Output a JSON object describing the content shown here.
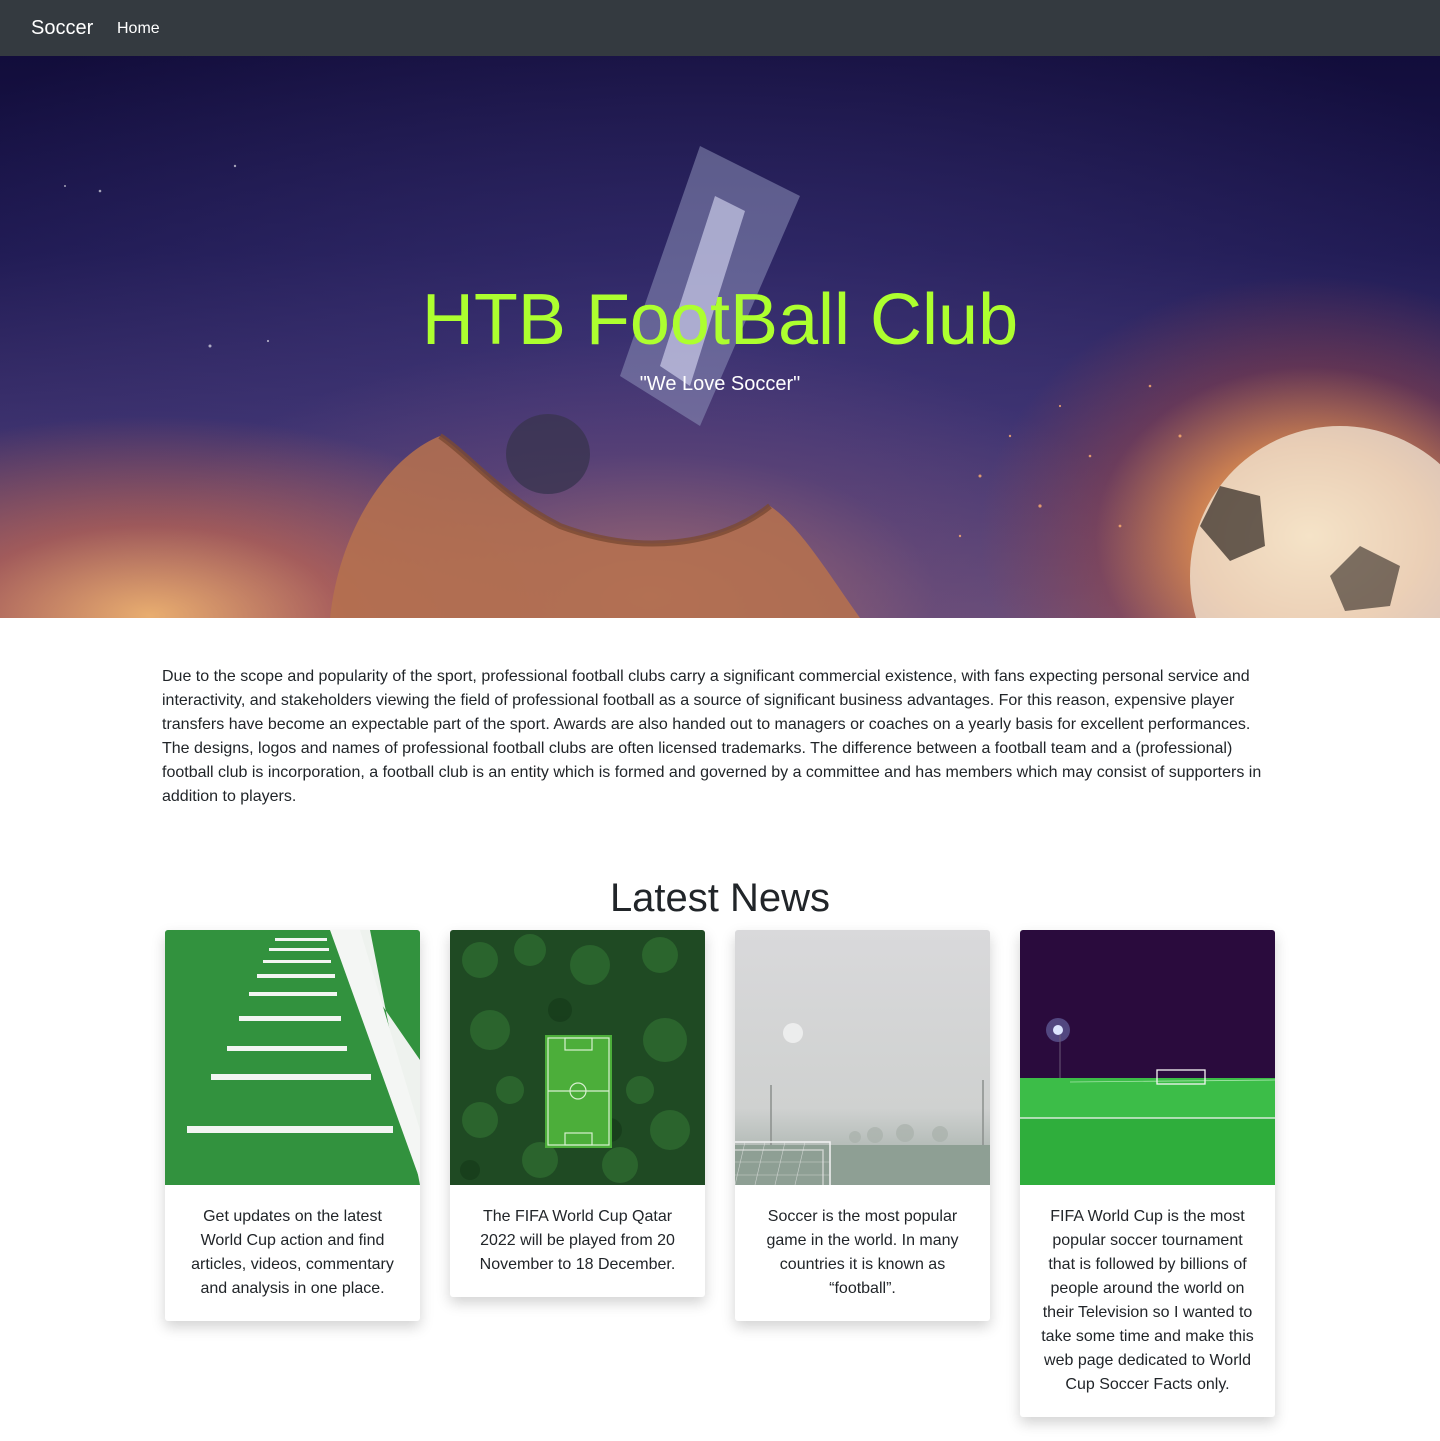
{
  "navbar": {
    "brand": "Soccer",
    "links": [
      {
        "label": "Home"
      }
    ]
  },
  "hero": {
    "title": "HTB FootBall Club",
    "subtitle": "\"We Love Soccer\"",
    "title_color": "#adff2f"
  },
  "intro": {
    "text": "Due to the scope and popularity of the sport, professional football clubs carry a significant commercial existence, with fans expecting personal service and interactivity, and stakeholders viewing the field of professional football as a source of significant business advantages. For this reason, expensive player transfers have become an expectable part of the sport. Awards are also handed out to managers or coaches on a yearly basis for excellent performances. The designs, logos and names of professional football clubs are often licensed trademarks. The difference between a football team and a (professional) football club is incorporation, a football club is an entity which is formed and governed by a committee and has members which may consist of supporters in addition to players."
  },
  "news": {
    "heading": "Latest News",
    "cards": [
      {
        "image": "turf-yard-lines-image",
        "text": "Get updates on the latest World Cup action and find articles, videos, commentary and analysis in one place."
      },
      {
        "image": "aerial-pitch-in-forest-image",
        "text": "The FIFA World Cup Qatar 2022 will be played from 20 November to 18 December."
      },
      {
        "image": "foggy-pitch-goal-image",
        "text": "Soccer is the most popular game in the world. In many countries it is known as “football”."
      },
      {
        "image": "night-stadium-pitch-image",
        "text": "FIFA World Cup is the most popular soccer tournament that is followed by billions of people around the world on their Television so I wanted to take some time and make this web page dedicated to World Cup Soccer Facts only."
      }
    ]
  },
  "colors": {
    "navbar": "#343a40",
    "accent": "#adff2f",
    "text": "#212529"
  }
}
